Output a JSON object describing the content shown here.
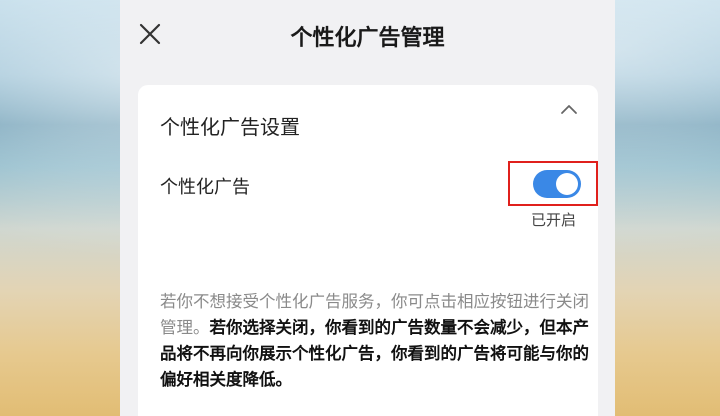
{
  "header": {
    "title": "个性化广告管理",
    "close_icon": "close-icon"
  },
  "card": {
    "section_title": "个性化广告设置",
    "collapse_icon": "chevron-up-icon",
    "setting": {
      "label": "个性化广告",
      "toggle_on": true,
      "status": "已开启",
      "accent": "#3a88e6",
      "highlight_color": "#e0201c"
    },
    "description": {
      "plain": "若你不想接受个性化广告服务，你可点击相应按钮进行关闭管理。",
      "bold": "若你选择关闭，你看到的广告数量不会减少，但本产品将不再向你展示个性化广告，你看到的广告将可能与你的偏好相关度降低。"
    }
  }
}
